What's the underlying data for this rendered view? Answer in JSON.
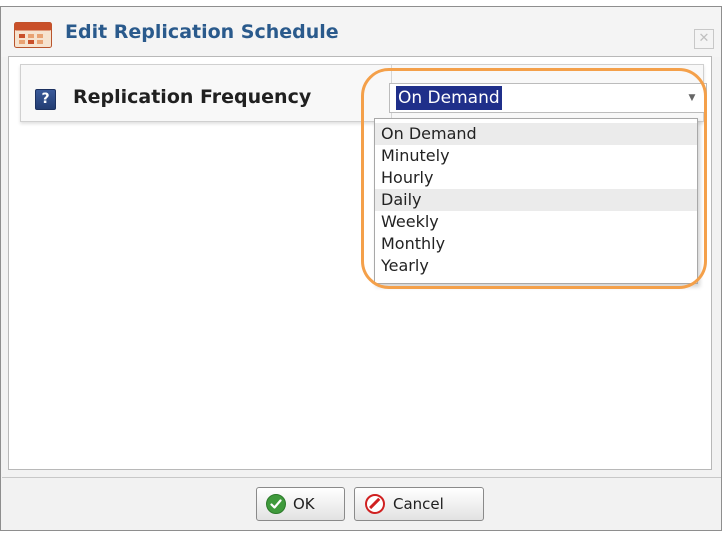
{
  "dialog": {
    "title": "Edit Replication Schedule",
    "close_symbol": "✕",
    "title_icon": "calendar-schedule-icon"
  },
  "field": {
    "help_symbol": "?",
    "label": "Replication Frequency",
    "selected_value": "On Demand",
    "options": [
      "On Demand",
      "Minutely",
      "Hourly",
      "Daily",
      "Weekly",
      "Monthly",
      "Yearly"
    ]
  },
  "buttons": {
    "ok": "OK",
    "cancel": "Cancel"
  },
  "colors": {
    "title_text": "#2a5a8c",
    "selection_highlight": "#1f2f8a",
    "annotation_ring": "#f4a04a",
    "ok_icon": "#3f9a3c",
    "cancel_icon": "#d02020"
  }
}
